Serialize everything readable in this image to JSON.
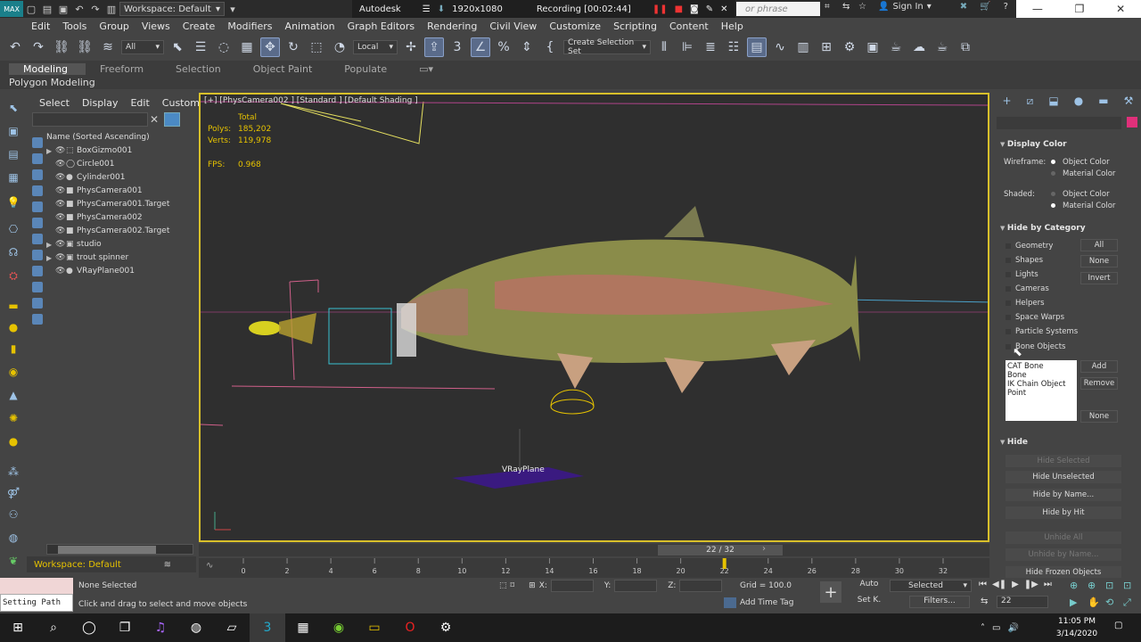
{
  "titlebar": {
    "workspace": "Workspace: Default",
    "app": "Autodesk",
    "resolution": "1920x1080",
    "recording": "Recording [00:02:44]",
    "search_placeholder": "or phrase",
    "sign_in": "Sign In"
  },
  "menu": [
    "Edit",
    "Tools",
    "Group",
    "Views",
    "Create",
    "Modifiers",
    "Animation",
    "Graph Editors",
    "Rendering",
    "Civil View",
    "Customize",
    "Scripting",
    "Content",
    "Help"
  ],
  "toolbar": {
    "filter": "All",
    "coord": "Local",
    "selection_set": "Create Selection Set"
  },
  "ribbon": {
    "tabs": [
      "Modeling",
      "Freeform",
      "Selection",
      "Object Paint",
      "Populate"
    ],
    "sub": "Polygon Modeling"
  },
  "explorer": {
    "menu": [
      "Select",
      "Display",
      "Edit",
      "Customize"
    ],
    "sort_header": "Name (Sorted Ascending)",
    "items": [
      "BoxGizmo001",
      "Circle001",
      "Cylinder001",
      "PhysCamera001",
      "PhysCamera001.Target",
      "PhysCamera002",
      "PhysCamera002.Target",
      "studio",
      "trout spinner",
      "VRayPlane001"
    ],
    "workspace": "Workspace: Default"
  },
  "viewport": {
    "label": "[+] [PhysCamera002 ] [Standard ] [Default Shading ]",
    "total": "Total",
    "polys_label": "Polys:",
    "polys": "185,202",
    "verts_label": "Verts:",
    "verts": "119,978",
    "fps_label": "FPS:",
    "fps": "0.968",
    "vray_label": "VRayPlane"
  },
  "timeline": {
    "slider": "22 / 32",
    "ticks": [
      "0",
      "2",
      "4",
      "6",
      "8",
      "10",
      "12",
      "14",
      "16",
      "18",
      "20",
      "22",
      "24",
      "26",
      "28",
      "30",
      "32"
    ],
    "current": 22,
    "max": 32
  },
  "status": {
    "script_cmd": "Setting Path",
    "selection": "None Selected",
    "prompt": "Click and drag to select and move objects",
    "x_label": "X:",
    "y_label": "Y:",
    "z_label": "Z:",
    "grid": "Grid = 100.0",
    "add_time_tag": "Add Time Tag",
    "auto": "Auto",
    "set_k": "Set K.",
    "selected": "Selected",
    "filters": "Filters...",
    "frame": "22"
  },
  "cmdpanel": {
    "display_color": "Display Color",
    "wireframe": "Wireframe:",
    "shaded": "Shaded:",
    "object_color": "Object Color",
    "material_color": "Material Color",
    "hide_by_category": "Hide by Category",
    "categories": [
      "Geometry",
      "Shapes",
      "Lights",
      "Cameras",
      "Helpers",
      "Space Warps",
      "Particle Systems",
      "Bone Objects"
    ],
    "btn_all": "All",
    "btn_none": "None",
    "btn_invert": "Invert",
    "bone_list": [
      "CAT Bone",
      "Bone",
      "IK Chain Object",
      "Point"
    ],
    "btn_add": "Add",
    "btn_remove": "Remove",
    "btn_none2": "None",
    "hide": "Hide",
    "hide_buttons": [
      "Hide Selected",
      "Hide Unselected",
      "Hide by Name...",
      "Hide by Hit",
      "Unhide All",
      "Unhide by Name...",
      "Hide Frozen Objects"
    ]
  },
  "taskbar": {
    "time": "11:05 PM",
    "date": "3/14/2020"
  }
}
